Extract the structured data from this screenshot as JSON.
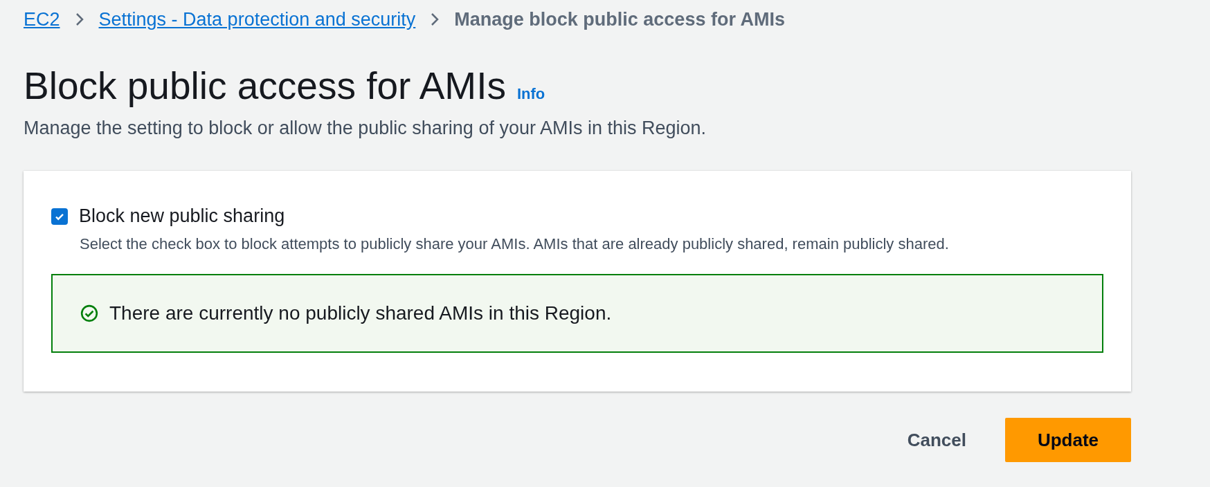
{
  "breadcrumbs": [
    {
      "label": "EC2",
      "kind": "link"
    },
    {
      "label": "Settings - Data protection and security",
      "kind": "link"
    },
    {
      "label": "Manage block public access for AMIs",
      "kind": "current"
    }
  ],
  "header": {
    "title": "Block public access for AMIs",
    "info": "Info",
    "description": "Manage the setting to block or allow the public sharing of your AMIs in this Region."
  },
  "setting": {
    "label": "Block new public sharing",
    "checked": true,
    "help": "Select the check box to block attempts to publicly share your AMIs. AMIs that are already publicly shared, remain publicly shared."
  },
  "alert": {
    "kind": "success",
    "message": "There are currently no publicly shared AMIs in this Region."
  },
  "buttons": [
    {
      "label": "Cancel",
      "kind": "link"
    },
    {
      "label": "Update",
      "kind": "primary"
    }
  ]
}
